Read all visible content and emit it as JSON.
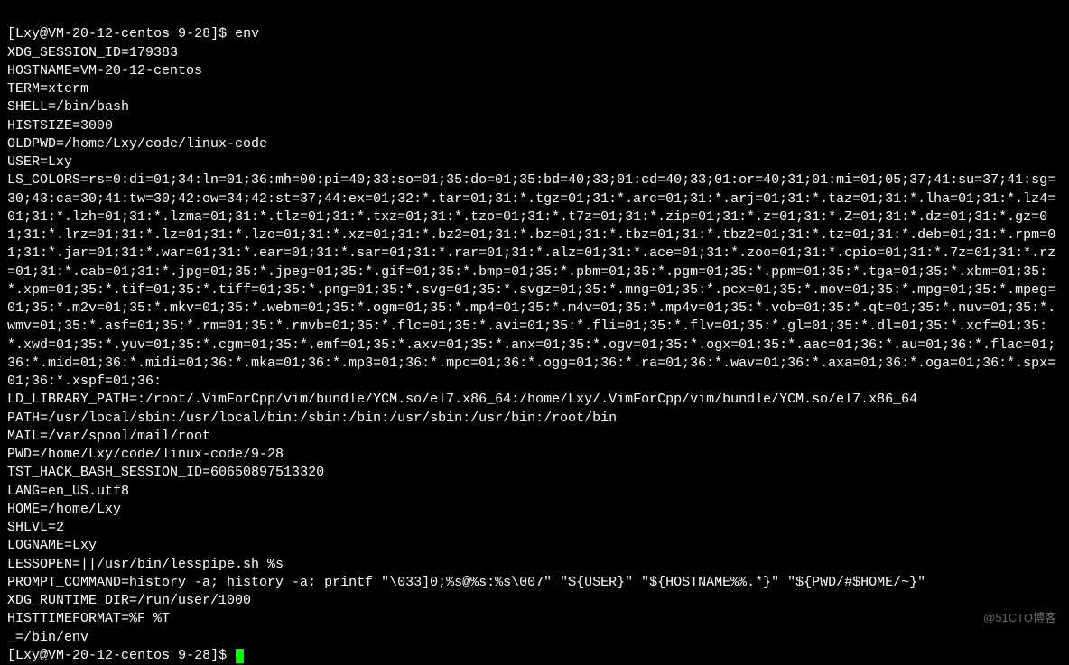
{
  "prompt1": {
    "user": "Lxy",
    "host": "VM-20-12-centos",
    "dir": "9-28",
    "command": "env"
  },
  "env": {
    "XDG_SESSION_ID": "179383",
    "HOSTNAME": "VM-20-12-centos",
    "TERM": "xterm",
    "SHELL": "/bin/bash",
    "HISTSIZE": "3000",
    "OLDPWD": "/home/Lxy/code/linux-code",
    "USER": "Lxy",
    "LS_COLORS": "rs=0:di=01;34:ln=01;36:mh=00:pi=40;33:so=01;35:do=01;35:bd=40;33;01:cd=40;33;01:or=40;31;01:mi=01;05;37;41:su=37;41:sg=30;43:ca=30;41:tw=30;42:ow=34;42:st=37;44:ex=01;32:*.tar=01;31:*.tgz=01;31:*.arc=01;31:*.arj=01;31:*.taz=01;31:*.lha=01;31:*.lz4=01;31:*.lzh=01;31:*.lzma=01;31:*.tlz=01;31:*.txz=01;31:*.tzo=01;31:*.t7z=01;31:*.zip=01;31:*.z=01;31:*.Z=01;31:*.dz=01;31:*.gz=01;31:*.lrz=01;31:*.lz=01;31:*.lzo=01;31:*.xz=01;31:*.bz2=01;31:*.bz=01;31:*.tbz=01;31:*.tbz2=01;31:*.tz=01;31:*.deb=01;31:*.rpm=01;31:*.jar=01;31:*.war=01;31:*.ear=01;31:*.sar=01;31:*.rar=01;31:*.alz=01;31:*.ace=01;31:*.zoo=01;31:*.cpio=01;31:*.7z=01;31:*.rz=01;31:*.cab=01;31:*.jpg=01;35:*.jpeg=01;35:*.gif=01;35:*.bmp=01;35:*.pbm=01;35:*.pgm=01;35:*.ppm=01;35:*.tga=01;35:*.xbm=01;35:*.xpm=01;35:*.tif=01;35:*.tiff=01;35:*.png=01;35:*.svg=01;35:*.svgz=01;35:*.mng=01;35:*.pcx=01;35:*.mov=01;35:*.mpg=01;35:*.mpeg=01;35:*.m2v=01;35:*.mkv=01;35:*.webm=01;35:*.ogm=01;35:*.mp4=01;35:*.m4v=01;35:*.mp4v=01;35:*.vob=01;35:*.qt=01;35:*.nuv=01;35:*.wmv=01;35:*.asf=01;35:*.rm=01;35:*.rmvb=01;35:*.flc=01;35:*.avi=01;35:*.fli=01;35:*.flv=01;35:*.gl=01;35:*.dl=01;35:*.xcf=01;35:*.xwd=01;35:*.yuv=01;35:*.cgm=01;35:*.emf=01;35:*.axv=01;35:*.anx=01;35:*.ogv=01;35:*.ogx=01;35:*.aac=01;36:*.au=01;36:*.flac=01;36:*.mid=01;36:*.midi=01;36:*.mka=01;36:*.mp3=01;36:*.mpc=01;36:*.ogg=01;36:*.ra=01;36:*.wav=01;36:*.axa=01;36:*.oga=01;36:*.spx=01;36:*.xspf=01;36:",
    "LD_LIBRARY_PATH": ":/root/.VimForCpp/vim/bundle/YCM.so/el7.x86_64:/home/Lxy/.VimForCpp/vim/bundle/YCM.so/el7.x86_64",
    "PATH": "/usr/local/sbin:/usr/local/bin:/sbin:/bin:/usr/sbin:/usr/bin:/root/bin",
    "MAIL": "/var/spool/mail/root",
    "PWD": "/home/Lxy/code/linux-code/9-28",
    "TST_HACK_BASH_SESSION_ID": "60650897513320",
    "LANG": "en_US.utf8",
    "HOME": "/home/Lxy",
    "SHLVL": "2",
    "LOGNAME": "Lxy",
    "LESSOPEN": "||/usr/bin/lesspipe.sh %s",
    "PROMPT_COMMAND": "history -a; history -a; printf \"\\033]0;%s@%s:%s\\007\" \"${USER}\" \"${HOSTNAME%%.*}\" \"${PWD/#$HOME/~}\"",
    "XDG_RUNTIME_DIR": "/run/user/1000",
    "HISTTIMEFORMAT": "%F %T ",
    "_": "/bin/env"
  },
  "prompt2": {
    "user": "Lxy",
    "host": "VM-20-12-centos",
    "dir": "9-28"
  },
  "watermark": "@51CTO博客"
}
